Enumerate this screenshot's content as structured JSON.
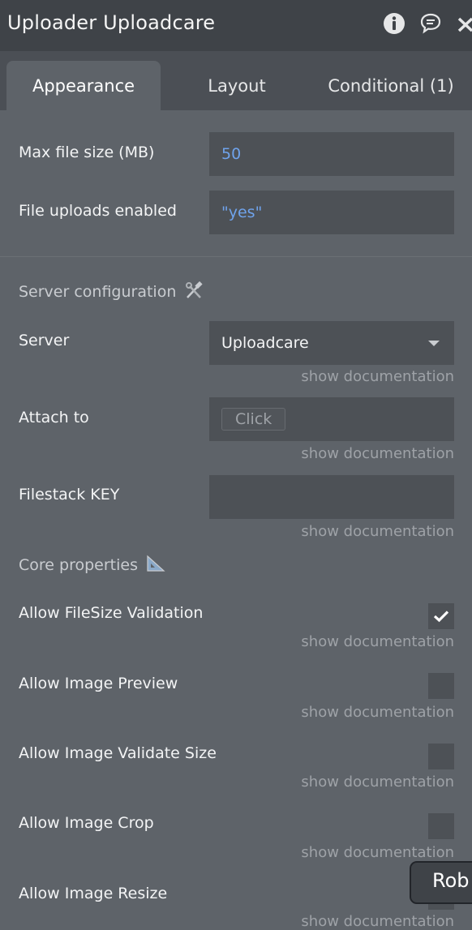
{
  "header": {
    "title": "Uploader Uploadcare",
    "icons": [
      "info-icon",
      "comment-icon",
      "close-icon"
    ]
  },
  "tabs": [
    {
      "label": "Appearance",
      "active": true
    },
    {
      "label": "Layout",
      "active": false
    },
    {
      "label": "Conditional (1)",
      "active": false
    }
  ],
  "fields": {
    "max_file_size": {
      "label": "Max file size (MB)",
      "value": "50"
    },
    "file_uploads_enabled": {
      "label": "File uploads enabled",
      "value": "\"yes\""
    }
  },
  "server_configuration": {
    "title": "Server configuration",
    "title_icon": "hammer-wrench-icon",
    "server": {
      "label": "Server",
      "value": "Uploadcare",
      "doc": "show documentation"
    },
    "attach_to": {
      "label": "Attach to",
      "button": "Click",
      "doc": "show documentation"
    },
    "filestack_key": {
      "label": "Filestack KEY",
      "value": "",
      "doc": "show documentation"
    }
  },
  "core_properties": {
    "title": "Core properties",
    "title_icon": "triangle-ruler-icon",
    "items": [
      {
        "label": "Allow FileSize Validation",
        "checked": true,
        "doc": "show documentation"
      },
      {
        "label": "Allow Image Preview",
        "checked": false,
        "doc": "show documentation"
      },
      {
        "label": "Allow Image Validate Size",
        "checked": false,
        "doc": "show documentation"
      },
      {
        "label": "Allow Image Crop",
        "checked": false,
        "doc": "show documentation"
      },
      {
        "label": "Allow Image Resize",
        "checked": false,
        "doc": "show documentation"
      }
    ]
  },
  "tooltip": {
    "text": "Rob"
  },
  "colors": {
    "panel_bg": "#5e6369",
    "header_bg": "#3f4348",
    "field_bg": "#4d5156",
    "value_blue": "#6fa3ec"
  }
}
